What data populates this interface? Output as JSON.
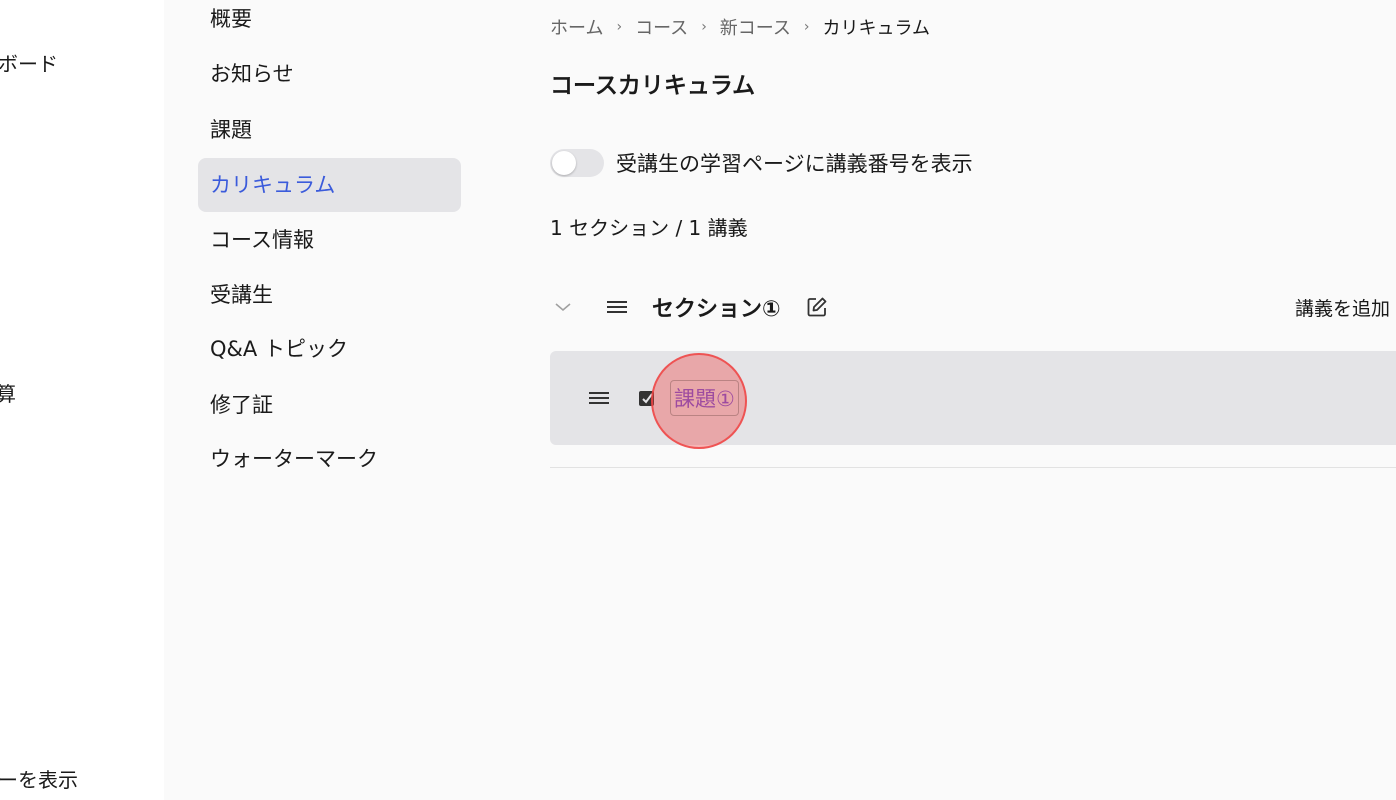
{
  "global_sidebar": {
    "items": [
      {
        "label": "ボード"
      },
      {
        "label": ""
      },
      {
        "label": "算"
      },
      {
        "label": "ーを表示"
      }
    ]
  },
  "course_nav": {
    "items": [
      {
        "label": "概要"
      },
      {
        "label": "お知らせ"
      },
      {
        "label": "課題"
      },
      {
        "label": "カリキュラム",
        "active": true
      },
      {
        "label": "コース情報"
      },
      {
        "label": "受講生"
      },
      {
        "label": "Q&A トピック"
      },
      {
        "label": "修了証"
      },
      {
        "label": "ウォーターマーク"
      }
    ]
  },
  "breadcrumb": {
    "items": [
      "ホーム",
      "コース",
      "新コース",
      "カリキュラム"
    ],
    "separator": "›"
  },
  "page": {
    "title": "コースカリキュラム",
    "toggle_label": "受講生の学習ページに講義番号を表示",
    "toggle_on": false,
    "counts": "1 セクション / 1 講義"
  },
  "section": {
    "title": "セクション①",
    "add_lecture_label": "講義を追加",
    "lectures": [
      {
        "title": "課題①"
      }
    ]
  },
  "colors": {
    "accent": "#3b5bdb",
    "lecture_link": "#6b4fd8",
    "highlight_bg": "#e4e4e7",
    "click_marker": "#ef4444"
  }
}
